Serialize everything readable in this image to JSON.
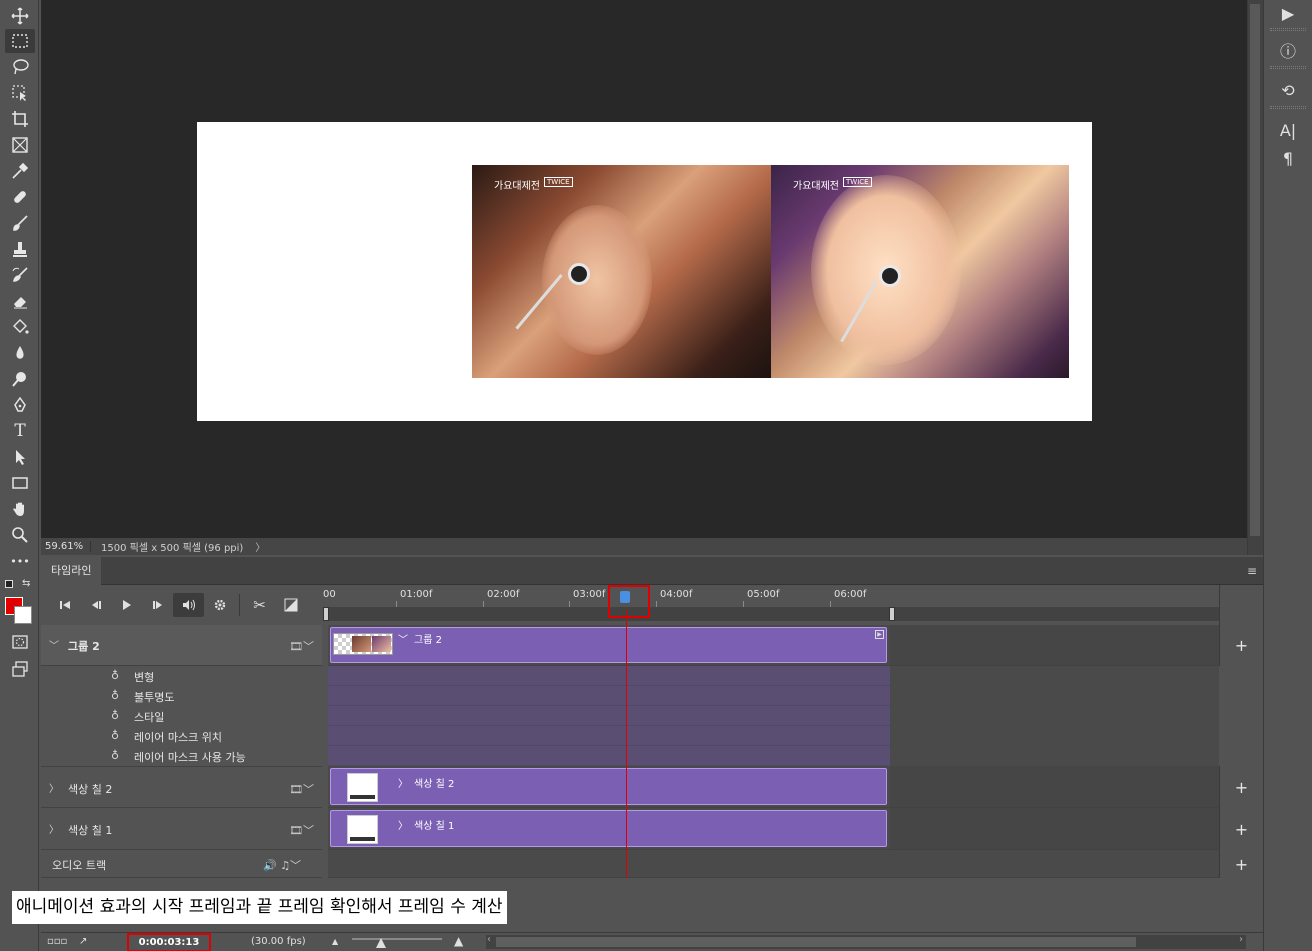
{
  "tools": [
    "move-tool",
    "marquee-tool",
    "lasso-tool",
    "object-select-tool",
    "crop-tool",
    "frame-tool",
    "eyedropper-tool",
    "healing-brush-tool",
    "brush-tool",
    "clone-stamp-tool",
    "history-brush-tool",
    "eraser-tool",
    "paint-bucket-tool",
    "blur-tool",
    "dodge-tool",
    "pen-tool",
    "type-tool",
    "path-select-tool",
    "rectangle-tool",
    "hand-tool",
    "zoom-tool",
    "more-tools"
  ],
  "type_tool_glyph": "T",
  "more_glyph": "•••",
  "canvas": {
    "photo_a_logo": "가요대제전",
    "photo_a_tag": "TWICE",
    "photo_b_logo": "가요대제전",
    "photo_b_tag": "TWICE"
  },
  "status": {
    "zoom": "59.61%",
    "doc_info": "1500 픽셀 x 500 픽셀 (96 ppi)",
    "chevron": "〉"
  },
  "right_panel": {
    "play": "▶",
    "info": "ⓘ",
    "history": "⟲",
    "char": "A|",
    "para": "¶"
  },
  "timeline": {
    "tab": "타임라인",
    "menu": "≡",
    "controls": {
      "first": "⏮",
      "prev": "◀|",
      "play": "▶",
      "next": "|▶",
      "audio": "🔊",
      "settings": "⚙",
      "split": "✂",
      "transition": "◪"
    },
    "ruler": [
      "00",
      "01:00f",
      "02:00f",
      "03:00f",
      "04:00f",
      "05:00f",
      "06:00f"
    ],
    "layers": {
      "group": {
        "name": "그룹 2",
        "clip": "그룹 2",
        "chev": "﹀"
      },
      "props": [
        "변형",
        "불투명도",
        "스타일",
        "레이어 마스크 위치",
        "레이어 마스크 사용 가능"
      ],
      "fill2": {
        "name": "색상 칠 2",
        "clip": "색상 칠 2",
        "chev": "〉"
      },
      "fill1": {
        "name": "색상 칠 1",
        "clip": "색상 칠 1",
        "chev": "〉"
      },
      "audio": {
        "name": "오디오 트랙"
      }
    },
    "film": "🎞﹀",
    "music": "🔊 ♫﹀",
    "add": "+",
    "stopwatch": "♁"
  },
  "caption": "애니메이션 효과의 시작 프레임과 끝 프레임 확인해서 프레임 수 계산",
  "bottom": {
    "time": "0:00:03:13",
    "fps": "(30.00 fps)",
    "frames_icon": "▫▫▫",
    "render_icon": "↗",
    "zoom_out": "▲",
    "zoom_in": "▲",
    "scroll_left": "‹",
    "scroll_right": "›"
  },
  "colors": {
    "foreground": "#e00000",
    "background": "#ffffff",
    "clip": "#7a5fb2",
    "playhead": "#e00000"
  }
}
